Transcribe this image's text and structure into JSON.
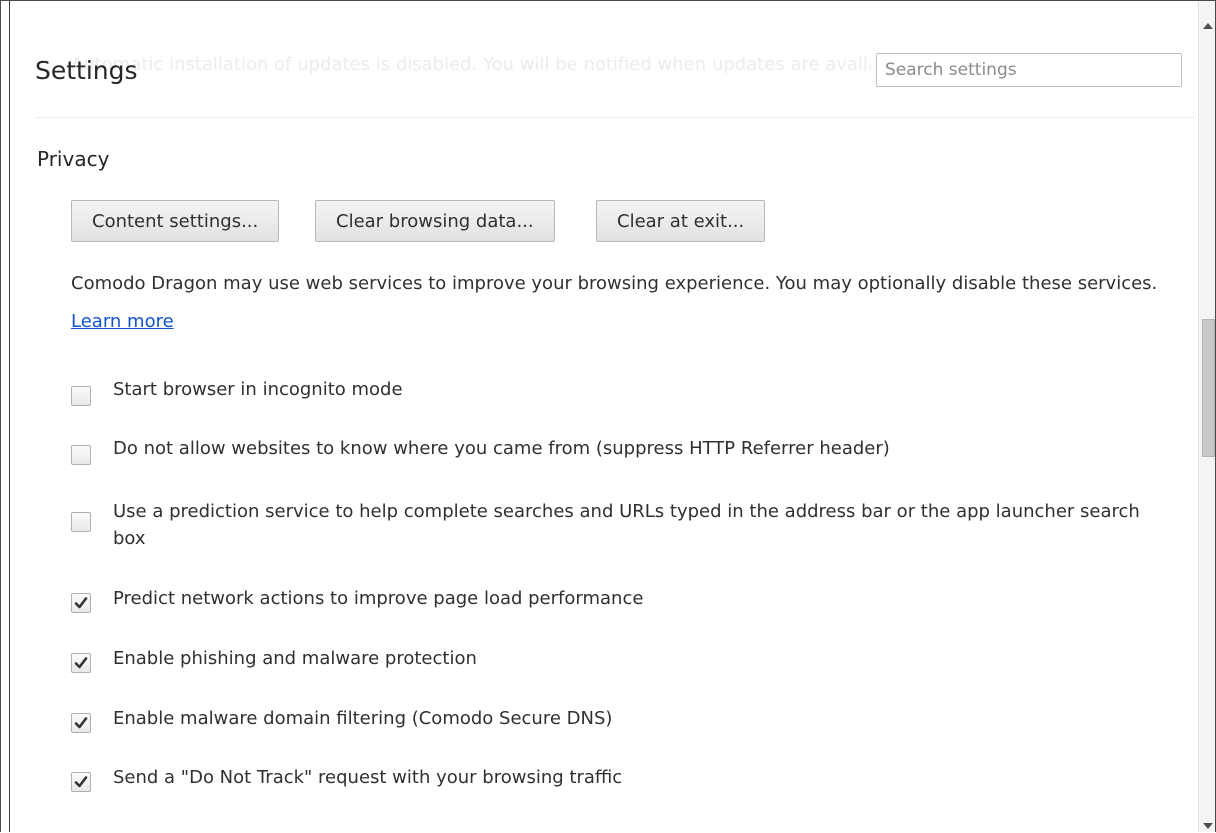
{
  "header": {
    "background_notice": "Automatic installation of updates is disabled. You will be notified when updates are available.",
    "title": "Settings",
    "search_placeholder": "Search settings"
  },
  "privacy": {
    "section_title": "Privacy",
    "buttons": {
      "content_settings": "Content settings...",
      "clear_browsing_data": "Clear browsing data...",
      "clear_at_exit": "Clear at exit..."
    },
    "description": "Comodo Dragon may use web services to improve your browsing experience. You may optionally disable these services.",
    "learn_more": "Learn more",
    "options": [
      {
        "label": "Start browser in incognito mode",
        "checked": false
      },
      {
        "label": "Do not allow websites to know where you came from (suppress HTTP Referrer header)",
        "checked": false
      },
      {
        "label": "Use a prediction service to help complete searches and URLs typed in the address bar or the app launcher search box",
        "checked": false
      },
      {
        "label": "Predict network actions to improve page load performance",
        "checked": true
      },
      {
        "label": "Enable phishing and malware protection",
        "checked": true
      },
      {
        "label": "Enable malware domain filtering (Comodo Secure DNS)",
        "checked": true
      },
      {
        "label": "Send a \"Do Not Track\" request with your browsing traffic",
        "checked": true
      }
    ]
  },
  "icons": {
    "checkmark": "checkmark-icon",
    "scroll_up": "scroll-up-arrow-icon",
    "scroll_down": "scroll-down-arrow-icon"
  }
}
